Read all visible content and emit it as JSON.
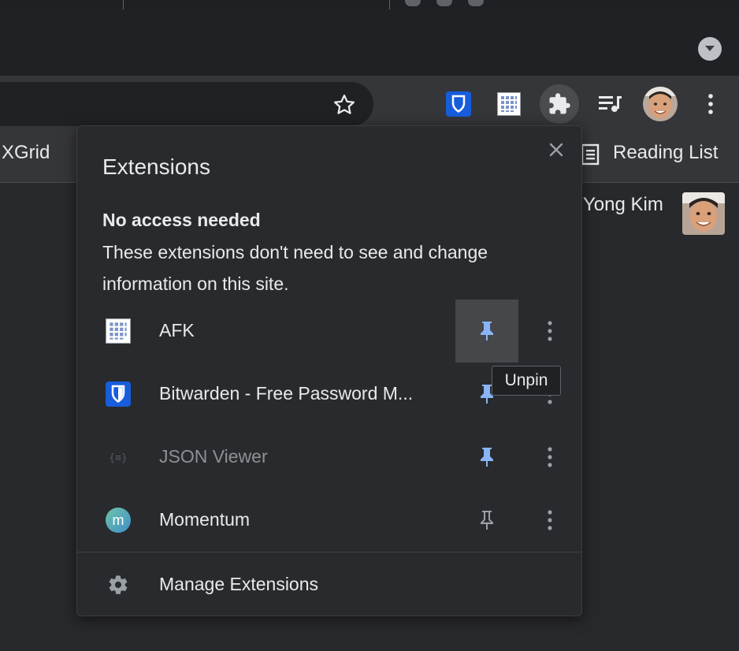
{
  "bookmarks": {
    "left_item": "XGrid",
    "reading_list": "Reading List"
  },
  "page": {
    "user_name": "Yong Kim"
  },
  "popup": {
    "title": "Extensions",
    "section_heading": "No access needed",
    "section_description": "These extensions don't need to see and change information on this site.",
    "extensions": [
      {
        "name": "AFK",
        "icon": "grid-icon",
        "pinned": true,
        "dimmed": false
      },
      {
        "name": "Bitwarden - Free Password M...",
        "icon": "bitwarden-shield-icon",
        "pinned": true,
        "dimmed": false
      },
      {
        "name": "JSON Viewer",
        "icon": "json-braces-icon",
        "pinned": true,
        "dimmed": true
      },
      {
        "name": "Momentum",
        "icon": "momentum-m-icon",
        "pinned": false,
        "dimmed": false
      }
    ],
    "tooltip": "Unpin",
    "manage_label": "Manage Extensions"
  },
  "colors": {
    "pin_active": "#8ab4f8",
    "pin_inactive": "#9aa0a6",
    "bitwarden": "#175ddc",
    "momentum": "#4fb3b9"
  }
}
